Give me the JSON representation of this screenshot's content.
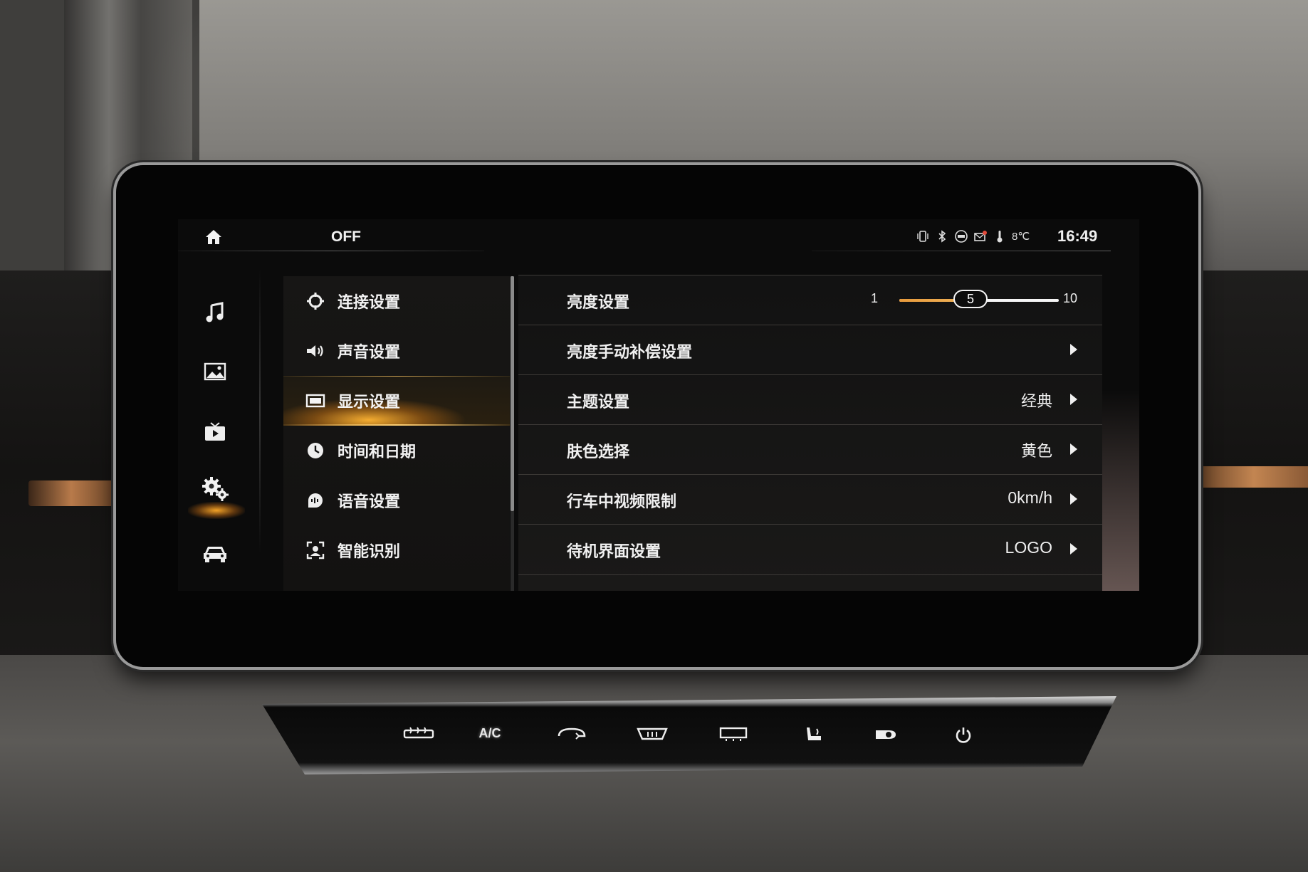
{
  "status_bar": {
    "mode_label": "OFF",
    "temperature": "8℃",
    "time": "16:49",
    "icons": [
      "vibrate-icon",
      "bluetooth-icon",
      "4g-icon",
      "message-icon",
      "temperature-icon"
    ]
  },
  "rail": {
    "items": [
      "music-icon",
      "gallery-icon",
      "video-icon",
      "settings-icon",
      "car-icon"
    ],
    "active_index": 3
  },
  "menu": {
    "items": [
      {
        "icon": "connection-icon",
        "label": "连接设置"
      },
      {
        "icon": "volume-icon",
        "label": "声音设置"
      },
      {
        "icon": "display-icon",
        "label": "显示设置"
      },
      {
        "icon": "clock-icon",
        "label": "时间和日期"
      },
      {
        "icon": "voice-icon",
        "label": "语音设置"
      },
      {
        "icon": "face-scan-icon",
        "label": "智能识别"
      }
    ],
    "active_index": 2
  },
  "settings": {
    "brightness": {
      "label": "亮度设置",
      "min": "1",
      "max": "10",
      "value": "5",
      "value_num": 5,
      "min_num": 1,
      "max_num": 10
    },
    "rows": [
      {
        "label": "亮度手动补偿设置",
        "value": ""
      },
      {
        "label": "主题设置",
        "value": "经典"
      },
      {
        "label": "肤色选择",
        "value": "黄色"
      },
      {
        "label": "行车中视频限制",
        "value": "0km/h"
      },
      {
        "label": "待机界面设置",
        "value": "LOGO"
      }
    ]
  },
  "hard_buttons": [
    "defrost-icon",
    "A/C",
    "recirculation-icon",
    "front-defrost-icon",
    "rear-defrost-icon",
    "seat-heat-icon",
    "fan-icon",
    "power-icon"
  ],
  "hard_button_labels": {
    "ac": "A/C"
  },
  "colors": {
    "accent": "#f0a844",
    "text": "#f0f0f0",
    "background": "#0b0b0b"
  }
}
